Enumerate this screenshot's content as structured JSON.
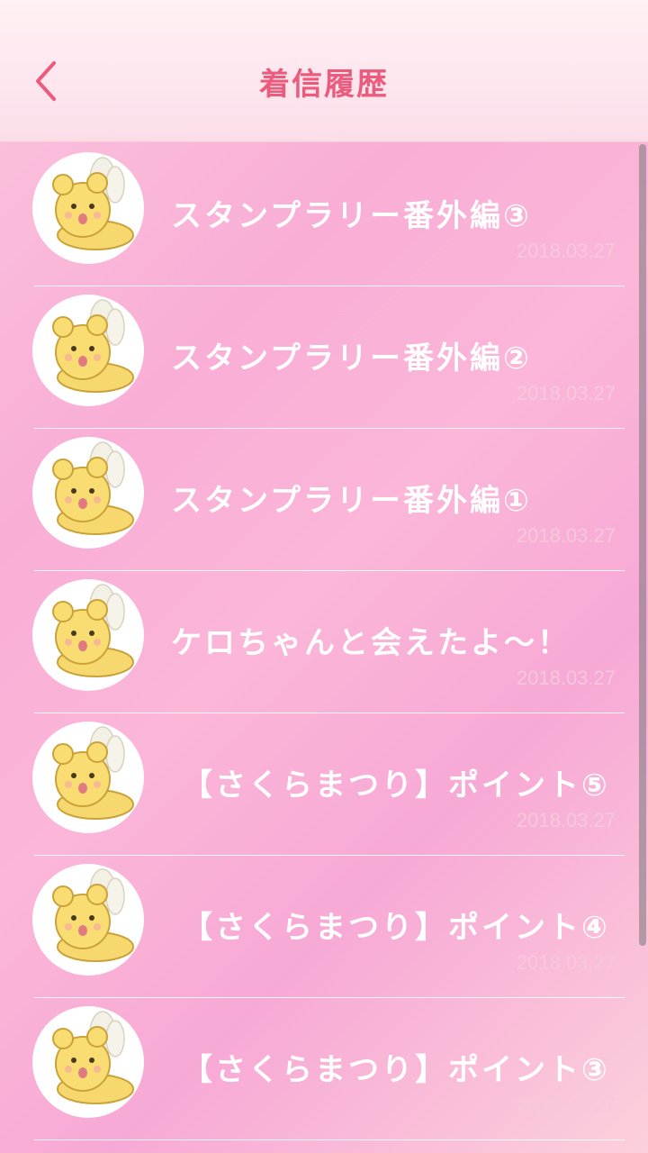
{
  "header": {
    "title": "着信履歴"
  },
  "calls": [
    {
      "title": "スタンプラリー番外編③",
      "date": "2018.03.27"
    },
    {
      "title": "スタンプラリー番外編②",
      "date": "2018.03.27"
    },
    {
      "title": "スタンプラリー番外編①",
      "date": "2018.03.27"
    },
    {
      "title": "ケロちゃんと会えたよ～！",
      "date": "2018.03.27"
    },
    {
      "title": "【さくらまつり】ポイント⑤",
      "date": "2018.03.27"
    },
    {
      "title": "【さくらまつり】ポイント④",
      "date": "2018.03.27"
    },
    {
      "title": "【さくらまつり】ポイント③",
      "date": "2018.03.27"
    }
  ],
  "colors": {
    "accent": "#ec5b7e",
    "date": "#f6c8dc"
  }
}
